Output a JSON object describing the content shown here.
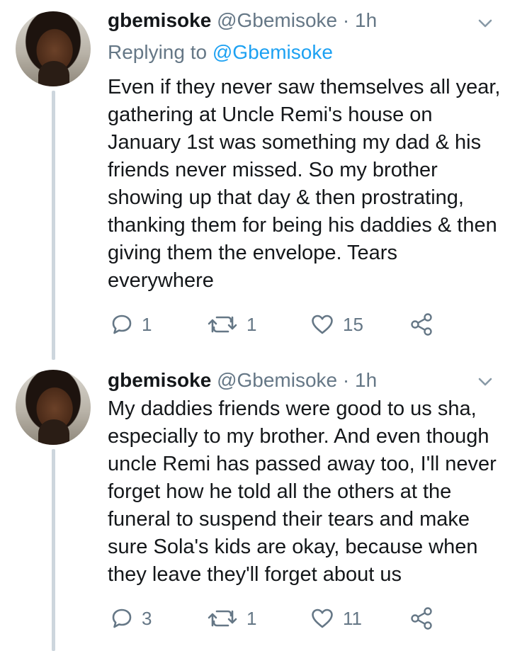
{
  "tweets": [
    {
      "display_name": "gbemisoke",
      "handle": "@Gbemisoke",
      "separator": "·",
      "time": "1h",
      "replying_prefix": "Replying to",
      "replying_handle": "@Gbemisoke",
      "text": "Even if they never saw themselves all year, gathering at Uncle Remi's house on January 1st was something my dad & his friends never missed. So my brother showing up that day & then prostrating, thanking them for being his daddies & then giving them the envelope. Tears everywhere",
      "replies": "1",
      "retweets": "1",
      "likes": "15"
    },
    {
      "display_name": "gbemisoke",
      "handle": "@Gbemisoke",
      "separator": "·",
      "time": "1h",
      "text": "My daddies friends were good to us sha, especially to my brother. And even though uncle Remi has passed away too, I'll never forget how he told all the others at the funeral to suspend their tears and make sure Sola's kids are okay, because when they leave they'll forget about us",
      "replies": "3",
      "retweets": "1",
      "likes": "11"
    }
  ],
  "icons": {
    "reply": "reply-icon",
    "retweet": "retweet-icon",
    "like": "heart-icon",
    "share": "share-icon",
    "menu": "chevron-down-icon"
  },
  "colors": {
    "text": "#14171a",
    "secondary": "#657786",
    "link": "#1da1f2",
    "thread_line": "#cdd6dd"
  }
}
